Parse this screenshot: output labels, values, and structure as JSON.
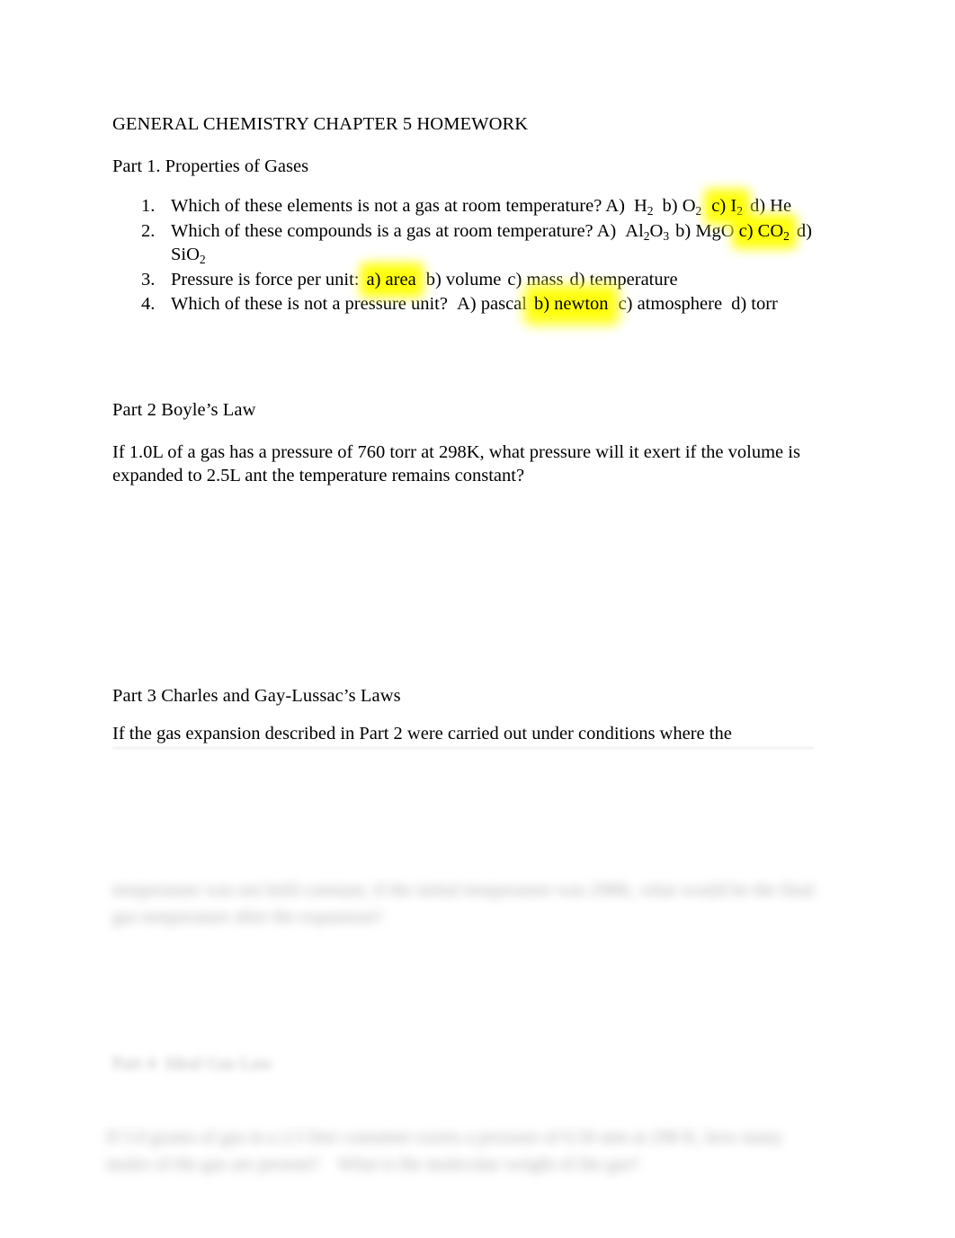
{
  "document": {
    "title": "GENERAL CHEMISTRY CHAPTER 5 HOMEWORK",
    "highlight_color": "#ffff00",
    "text_color": "#000000",
    "page_background": "#ffffff"
  },
  "part1": {
    "heading": "Part 1. Properties of Gases",
    "questions": [
      {
        "number": "1.",
        "prompt": "Which of these elements is not a gas at room temperature? A)",
        "choice_a": "H",
        "choice_a_sub": "2",
        "choice_b_label": "b)",
        "choice_b": "O",
        "choice_b_sub": "2",
        "choice_c_label": "c)",
        "choice_c": "I",
        "choice_c_sub": "2",
        "choice_c_highlighted": true,
        "choice_d_label": "d)",
        "choice_d": "He"
      },
      {
        "number": "2.",
        "prompt": "Which of these compounds is a gas at room temperature? A)",
        "choice_a_1": "Al",
        "choice_a_sub1": "2",
        "choice_a_2": "O",
        "choice_a_sub2": "3",
        "choice_b_label": "b)",
        "choice_b": "MgO",
        "choice_c_label": "c)",
        "choice_c": "CO",
        "choice_c_sub": "2",
        "choice_c_highlighted": true,
        "choice_d_label": "d)",
        "choice_d_wrap_1": "SiO",
        "choice_d_wrap_sub": "2"
      },
      {
        "number": "3.",
        "prompt": "Pressure is force per unit:",
        "choice_a": "a)  area",
        "choice_a_highlighted": true,
        "choice_b": "b)  volume",
        "choice_c": "c)  mass",
        "choice_d": "d)  temperature"
      },
      {
        "number": "4.",
        "prompt": "Which of these is not a pressure unit?",
        "choice_a": "A) pascal",
        "choice_b": "b)  newton",
        "choice_b_highlighted": true,
        "choice_c": "c)  atmosphere",
        "choice_d": "d)  torr"
      }
    ]
  },
  "part2": {
    "heading": "Part 2 Boyle’s Law",
    "body": "If 1.0L of a gas has a pressure of 760 torr at 298K, what pressure will it exert if the volume is expanded to 2.5L ant the temperature remains constant?"
  },
  "part3": {
    "heading": "Part 3  Charles and Gay-Lussac’s Laws",
    "body": "If the gas expansion described in Part 2 were carried out under conditions where the",
    "body_obscured": "temperature was not held constant, if the initial temperature was 298K, what would be the final gas temperature after the expansion?"
  },
  "part4": {
    "heading_obscured": "Part 4  Ideal Gas Law",
    "body_obscured": "If 5.0 grams of gas in a 2.5 liter container exerts a pressure of 0.50 atm at 298 K, how many moles of the gas are present?    What is the molecular weight of the gas?"
  }
}
